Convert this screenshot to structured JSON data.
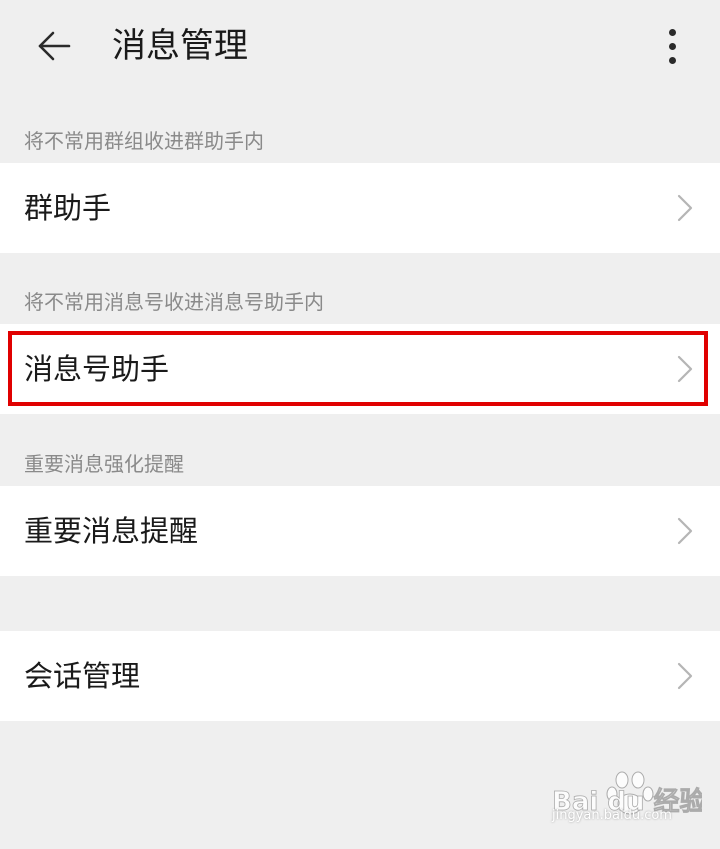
{
  "header": {
    "title": "消息管理",
    "back_icon": "arrow-left-icon",
    "more_icon": "more-vertical-icon"
  },
  "sections": [
    {
      "label": "将不常用群组收进群助手内",
      "item": "群助手"
    },
    {
      "label": "将不常用消息号收进消息号助手内",
      "item": "消息号助手"
    },
    {
      "label": "重要消息强化提醒",
      "item": "重要消息提醒"
    },
    {
      "label": "",
      "item": "会话管理"
    }
  ],
  "watermark": {
    "brand": "Bai du 经验",
    "url": "jingyan.baidu.com"
  },
  "colors": {
    "background": "#efefef",
    "row_background": "#ffffff",
    "highlight": "#e00000",
    "label_gray": "#8a8a8a"
  }
}
